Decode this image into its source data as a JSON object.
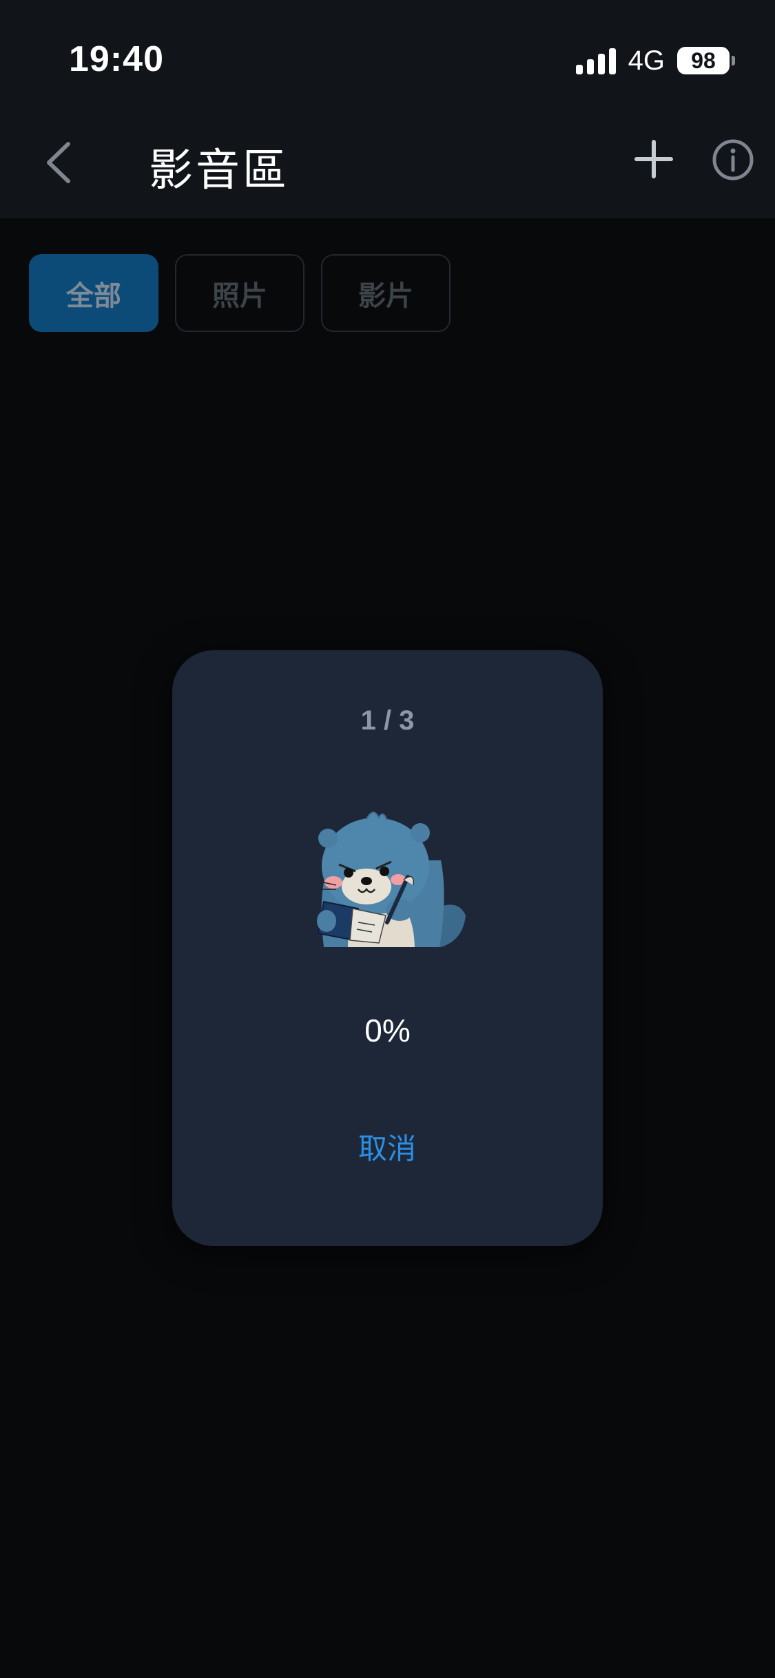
{
  "status_bar": {
    "time": "19:40",
    "network": "4G",
    "battery": "98"
  },
  "header": {
    "title": "影音區",
    "back_icon": "chevron-left-icon",
    "add_icon": "plus-icon",
    "info_icon": "info-circle-icon"
  },
  "filters": {
    "selected": "全部",
    "items": [
      {
        "label": "全部"
      },
      {
        "label": "照片"
      },
      {
        "label": "影片"
      }
    ]
  },
  "upload_dialog": {
    "counter": "1 / 3",
    "mascot_icon": "otter-mascot-icon",
    "progress_text": "0%",
    "progress_fraction": 0,
    "cancel_label": "取消"
  },
  "colors": {
    "accent": "#2b8fe3",
    "dialog_bg": "#1e2737",
    "header_bg": "#111419",
    "page_bg": "#08090b",
    "chip_active_bg": "#0c4a78"
  }
}
